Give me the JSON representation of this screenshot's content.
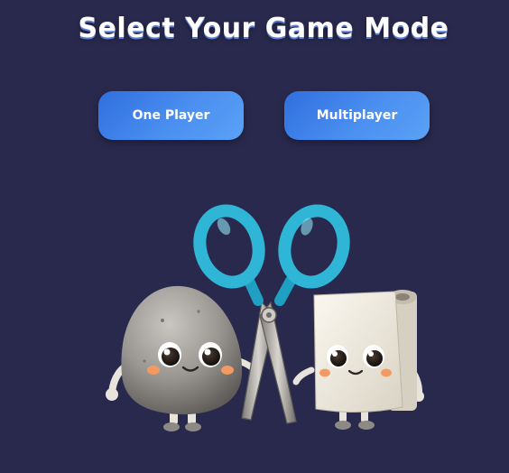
{
  "header": {
    "title": "Select Your Game Mode"
  },
  "mode_select": {
    "buttons": [
      {
        "label": "One Player"
      },
      {
        "label": "Multiplayer"
      }
    ]
  },
  "illustration": {
    "characters": [
      "rock",
      "scissors",
      "paper"
    ]
  },
  "colors": {
    "background": "#29294d",
    "button": "#3f86ec",
    "title": "#ffffff",
    "scissors_handle": "#2fb6d6"
  }
}
